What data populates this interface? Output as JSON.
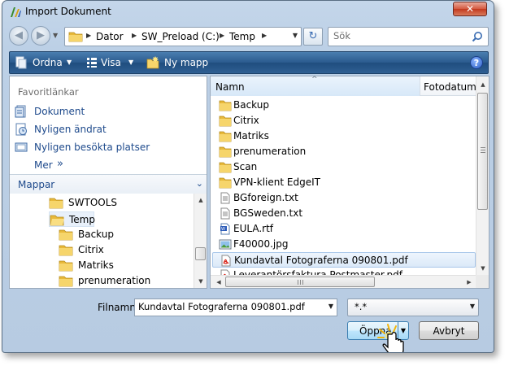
{
  "window": {
    "title": "Import Dokument",
    "close_glyph": "✕"
  },
  "nav": {
    "back_glyph": "◀",
    "forward_glyph": "▶",
    "breadcrumbs": [
      "Dator",
      "SW_Preload (C:)",
      "Temp"
    ],
    "refresh_glyph": "↻"
  },
  "search": {
    "placeholder": "Sök",
    "icon": "search-icon"
  },
  "toolbar": {
    "organize_label": "Ordna",
    "view_label": "Visa",
    "new_folder_label": "Ny mapp",
    "help_label": "?"
  },
  "sidebar": {
    "favorites_header": "Favoritlänkar",
    "favorites": [
      {
        "label": "Dokument",
        "icon": "documents-icon"
      },
      {
        "label": "Nyligen ändrat",
        "icon": "recent-changed-icon"
      },
      {
        "label": "Nyligen besökta platser",
        "icon": "recent-places-icon"
      }
    ],
    "more_label": "Mer",
    "more_chevron": "»",
    "folders_header": "Mappar",
    "folders_chevron": "⌄",
    "tree": [
      {
        "label": "SWTOOLS",
        "selected": false
      },
      {
        "label": "Temp",
        "selected": true
      },
      {
        "label": "Backup",
        "selected": false
      },
      {
        "label": "Citrix",
        "selected": false
      },
      {
        "label": "Matriks",
        "selected": false
      },
      {
        "label": "prenumeration",
        "selected": false
      }
    ]
  },
  "file_list": {
    "columns": [
      "Namn",
      "Fotodatum"
    ],
    "sort_glyph": "^",
    "items": [
      {
        "name": "Backup",
        "type": "folder"
      },
      {
        "name": "Citrix",
        "type": "folder"
      },
      {
        "name": "Matriks",
        "type": "folder"
      },
      {
        "name": "prenumeration",
        "type": "folder"
      },
      {
        "name": "Scan",
        "type": "folder"
      },
      {
        "name": "VPN-klient EdgeIT",
        "type": "folder"
      },
      {
        "name": "BGforeign.txt",
        "type": "txt"
      },
      {
        "name": "BGSweden.txt",
        "type": "txt"
      },
      {
        "name": "EULA.rtf",
        "type": "rtf"
      },
      {
        "name": "F40000.jpg",
        "type": "jpg"
      },
      {
        "name": "Kundavtal Fotograferna 090801.pdf",
        "type": "pdf",
        "selected": true
      },
      {
        "name": "Leverantörsfaktura Postmaster.pdf",
        "type": "pdf"
      }
    ]
  },
  "footer": {
    "filename_label": "Filnamn:",
    "filename_value": "Kundavtal Fotograferna 090801.pdf",
    "filter_value": "*.*",
    "open_label": "Öppna",
    "cancel_label": "Avbryt"
  },
  "colors": {
    "accent": "#1e4a8c",
    "toolbar": "#2a5a8e",
    "folder": "#f2c94c"
  }
}
